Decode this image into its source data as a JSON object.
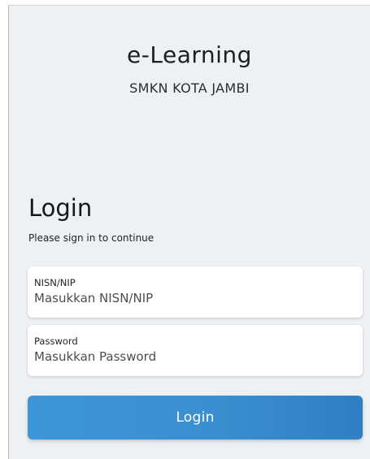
{
  "header": {
    "app_title": "e-Learning",
    "school_name": "SMKN KOTA JAMBI"
  },
  "login": {
    "heading": "Login",
    "subtitle": "Please sign in to continue",
    "nisn_field": {
      "label": "NISN/NIP",
      "value": "",
      "placeholder": "Masukkan NISN/NIP"
    },
    "password_field": {
      "label": "Password",
      "value": "",
      "placeholder": "Masukkan Password"
    },
    "submit_label": "Login"
  },
  "colors": {
    "background": "#eef1f3",
    "button_primary": "#3a8fd0",
    "card": "#ffffff"
  }
}
